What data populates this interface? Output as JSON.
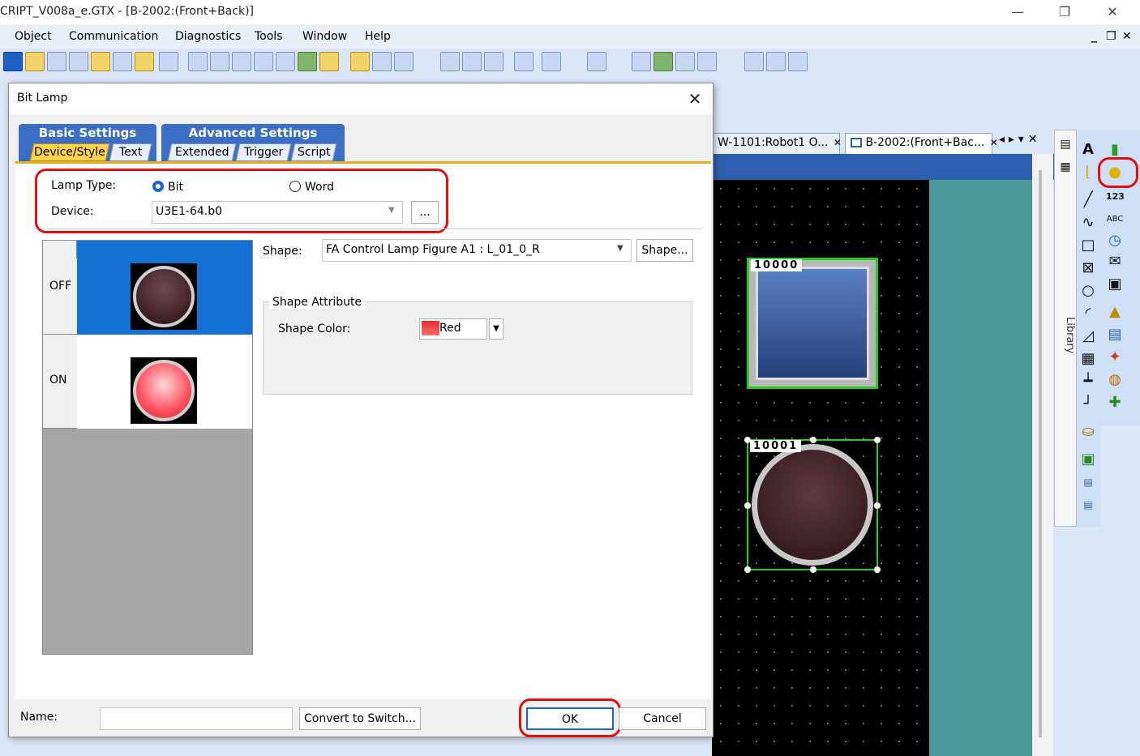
{
  "window": {
    "title": "CRIPT_V008a_e.GTX - [B-2002:(Front+Back)]",
    "min": "—",
    "restore": "❐",
    "close": "✕",
    "doc_min": "_",
    "doc_restore": "❐",
    "doc_close": "✕"
  },
  "menu": [
    "Object",
    "Communication",
    "Diagnostics",
    "Tools",
    "Window",
    "Help"
  ],
  "doc_tabs": {
    "tab1": "W-1101:Robot1 O...",
    "tab2": "B-2002:(Front+Bac...",
    "close": "✕",
    "nav": "◂ ▸ ▾ ✕"
  },
  "library": {
    "label": "Library"
  },
  "canvas": {
    "lamp1_id": "10000",
    "lamp2_id": "10001"
  },
  "dialog": {
    "title": "Bit Lamp",
    "close": "✕",
    "groups": {
      "basic": "Basic Settings",
      "advanced": "Advanced Settings"
    },
    "tabs": [
      "Device/Style",
      "Text",
      "Extended",
      "Trigger",
      "Script"
    ],
    "lamp_type_label": "Lamp Type:",
    "bit_label": "Bit",
    "word_label": "Word",
    "device_label": "Device:",
    "device_value": "U3E1-64.b0",
    "browse_label": "...",
    "states": {
      "off": "OFF",
      "on": "ON"
    },
    "shape_label": "Shape:",
    "shape_value": "FA Control Lamp Figure A1 : L_01_0_R",
    "shape_button": "Shape...",
    "attr_title": "Shape Attribute",
    "shape_color_label": "Shape Color:",
    "shape_color_value": "Red",
    "name_label": "Name:",
    "name_value": "",
    "convert_button": "Convert to Switch...",
    "ok_button": "OK",
    "cancel_button": "Cancel"
  },
  "colors": {
    "highlight": "#e01010",
    "accent": "#1a64d6",
    "selection": "#1470d2",
    "canvas_bg": "#000000",
    "teal": "#4a9a9a"
  }
}
